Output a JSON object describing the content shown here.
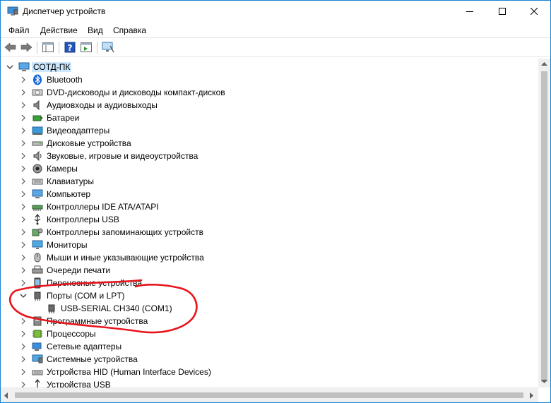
{
  "window": {
    "title": "Диспетчер устройств"
  },
  "menu": [
    {
      "key": "file",
      "label": "Файл"
    },
    {
      "key": "action",
      "label": "Действие"
    },
    {
      "key": "view",
      "label": "Вид"
    },
    {
      "key": "help",
      "label": "Справка"
    }
  ],
  "tree": {
    "root": {
      "label": "СОТД-ПК",
      "icon": "computer-icon"
    },
    "nodes": [
      {
        "label": "Bluetooth",
        "icon": "bluetooth-icon"
      },
      {
        "label": "DVD-дисководы и дисководы компакт-дисков",
        "icon": "dvd-drive-icon"
      },
      {
        "label": "Аудиовходы и аудиовыходы",
        "icon": "audio-io-icon"
      },
      {
        "label": "Батареи",
        "icon": "battery-icon"
      },
      {
        "label": "Видеоадаптеры",
        "icon": "display-adapter-icon"
      },
      {
        "label": "Дисковые устройства",
        "icon": "disk-drive-icon"
      },
      {
        "label": "Звуковые, игровые и видеоустройства",
        "icon": "sound-icon"
      },
      {
        "label": "Камеры",
        "icon": "camera-icon"
      },
      {
        "label": "Клавиатуры",
        "icon": "keyboard-icon"
      },
      {
        "label": "Компьютер",
        "icon": "computer-icon"
      },
      {
        "label": "Контроллеры IDE ATA/ATAPI",
        "icon": "ide-controller-icon"
      },
      {
        "label": "Контроллеры USB",
        "icon": "usb-icon"
      },
      {
        "label": "Контроллеры запоминающих устройств",
        "icon": "storage-controller-icon"
      },
      {
        "label": "Мониторы",
        "icon": "monitor-icon"
      },
      {
        "label": "Мыши и иные указывающие устройства",
        "icon": "mouse-icon"
      },
      {
        "label": "Очереди печати",
        "icon": "printer-icon"
      },
      {
        "label": "Переносные устройства",
        "icon": "portable-device-icon"
      },
      {
        "label": "Порты (COM и LPT)",
        "icon": "port-icon",
        "expanded": true,
        "children": [
          {
            "label": "USB-SERIAL CH340 (COM1)",
            "icon": "port-icon"
          }
        ]
      },
      {
        "label": "Программные устройства",
        "icon": "software-device-icon"
      },
      {
        "label": "Процессоры",
        "icon": "processor-icon"
      },
      {
        "label": "Сетевые адаптеры",
        "icon": "network-adapter-icon"
      },
      {
        "label": "Системные устройства",
        "icon": "system-device-icon"
      },
      {
        "label": "Устройства HID (Human Interface Devices)",
        "icon": "hid-icon"
      },
      {
        "label": "Устройства USB",
        "icon": "usb-device-icon"
      }
    ]
  },
  "annotation": {
    "color": "#e8141c",
    "target": "Порты (COM и LPT)"
  }
}
